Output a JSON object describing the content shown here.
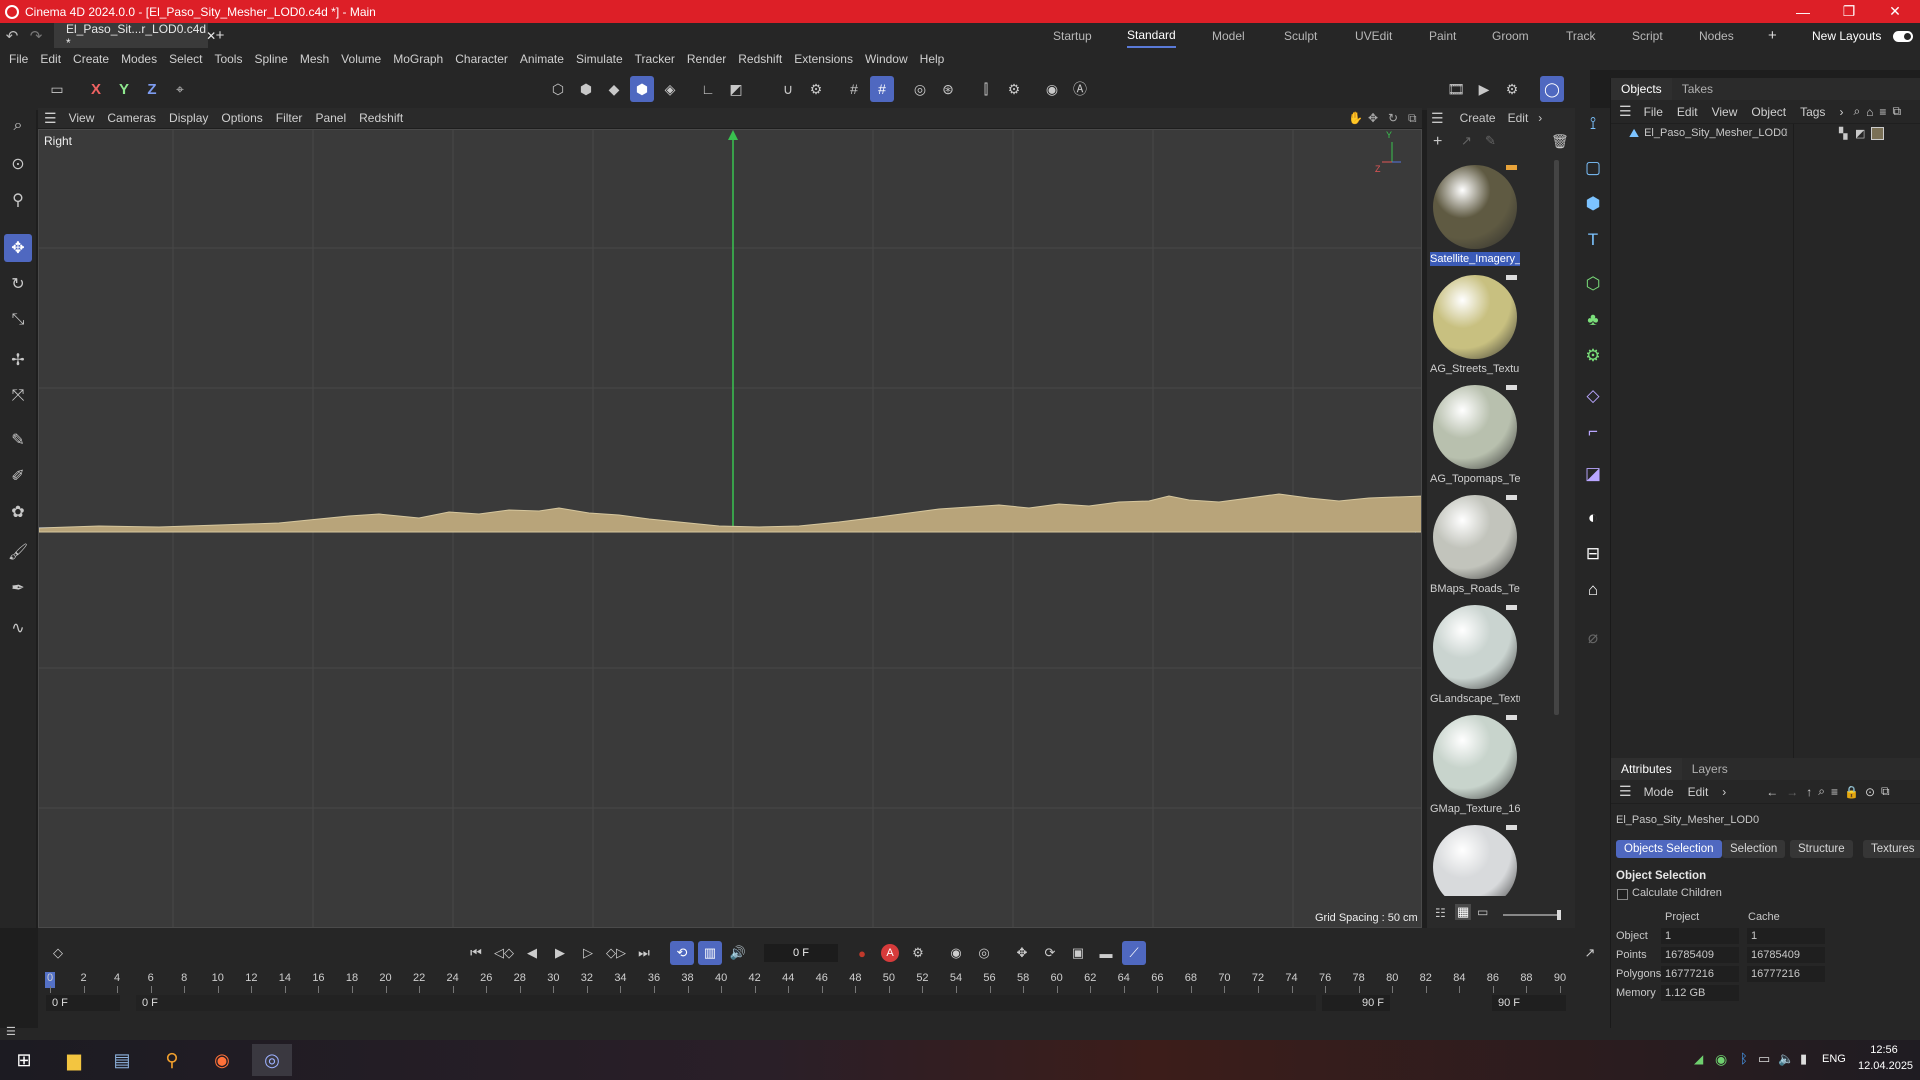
{
  "window": {
    "title": "Cinema 4D 2024.0.0 - [El_Paso_Sity_Mesher_LOD0.c4d *] - Main",
    "minimize": "—",
    "maximize": "❐",
    "close": "✕"
  },
  "doc_tab": {
    "label": "El_Paso_Sit...r_LOD0.c4d *",
    "close": "✕"
  },
  "layouts": {
    "items": [
      "Startup",
      "Standard",
      "Model",
      "Sculpt",
      "UVEdit",
      "Paint",
      "Groom",
      "Track",
      "Script",
      "Nodes"
    ],
    "active": "Standard",
    "new_layouts": "New Layouts"
  },
  "menu": [
    "File",
    "Edit",
    "Create",
    "Modes",
    "Select",
    "Tools",
    "Spline",
    "Mesh",
    "Volume",
    "MoGraph",
    "Character",
    "Animate",
    "Simulate",
    "Tracker",
    "Render",
    "Redshift",
    "Extensions",
    "Window",
    "Help"
  ],
  "axis_lock": {
    "x": "X",
    "y": "Y",
    "z": "Z"
  },
  "viewport": {
    "menu": [
      "View",
      "Cameras",
      "Display",
      "Options",
      "Filter",
      "Panel",
      "Redshift"
    ],
    "camera_label": "Right",
    "grid_spacing": "Grid Spacing : 50 cm",
    "axis_y": "Y",
    "axis_z": "Z",
    "grid_color": "#484848",
    "bg_color": "#3a3a3a"
  },
  "materials": {
    "menu": [
      "Create",
      "Edit"
    ],
    "items": [
      {
        "name": "Satellite_Imagery_",
        "color": "#5f5a42",
        "selected": true
      },
      {
        "name": "AG_Streets_Textur",
        "color": "#c8c080",
        "selected": false
      },
      {
        "name": "AG_Topomaps_Te:",
        "color": "#b8c0ae",
        "selected": false
      },
      {
        "name": "BMaps_Roads_Tex",
        "color": "#c2c4bc",
        "selected": false
      },
      {
        "name": "GLandscape_Textu",
        "color": "#cad4d0",
        "selected": false
      },
      {
        "name": "GMap_Texture_16",
        "color": "#c8d4cc",
        "selected": false
      },
      {
        "name": "",
        "color": "#d8dadc",
        "selected": false
      }
    ]
  },
  "objects_panel": {
    "tabs": [
      "Objects",
      "Takes"
    ],
    "menu": [
      "File",
      "Edit",
      "View",
      "Object",
      "Tags"
    ],
    "object_name": "El_Paso_Sity_Mesher_LOD0"
  },
  "attributes_panel": {
    "tabs": [
      "Attributes",
      "Layers"
    ],
    "menu": [
      "Mode",
      "Edit"
    ],
    "object_name": "El_Paso_Sity_Mesher_LOD0",
    "subtabs": [
      "Objects Selection",
      "Selection",
      "Structure",
      "Textures"
    ],
    "section_title": "Object Selection",
    "checkbox_label": "Calculate Children",
    "col_project": "Project",
    "col_cache": "Cache",
    "rows": [
      {
        "label": "Object",
        "project": "1",
        "cache": "1"
      },
      {
        "label": "Points",
        "project": "16785409",
        "cache": "16785409"
      },
      {
        "label": "Polygons",
        "project": "16777216",
        "cache": "16777216"
      },
      {
        "label": "Memory",
        "project": "1.12 GB",
        "cache": ""
      }
    ]
  },
  "timeline": {
    "current_frame": "0 F",
    "ticks": [
      "0",
      "2",
      "4",
      "6",
      "8",
      "10",
      "12",
      "14",
      "16",
      "18",
      "20",
      "22",
      "24",
      "26",
      "28",
      "30",
      "32",
      "34",
      "36",
      "38",
      "40",
      "42",
      "44",
      "46",
      "48",
      "50",
      "52",
      "54",
      "56",
      "58",
      "60",
      "62",
      "64",
      "66",
      "68",
      "70",
      "72",
      "74",
      "76",
      "78",
      "80",
      "82",
      "84",
      "86",
      "88",
      "90"
    ],
    "start_a": "0 F",
    "start_b": "0 F",
    "end_a": "90 F",
    "end_b": "90 F"
  },
  "taskbar": {
    "lang": "ENG",
    "time": "12:56",
    "date": "12.04.2025"
  }
}
